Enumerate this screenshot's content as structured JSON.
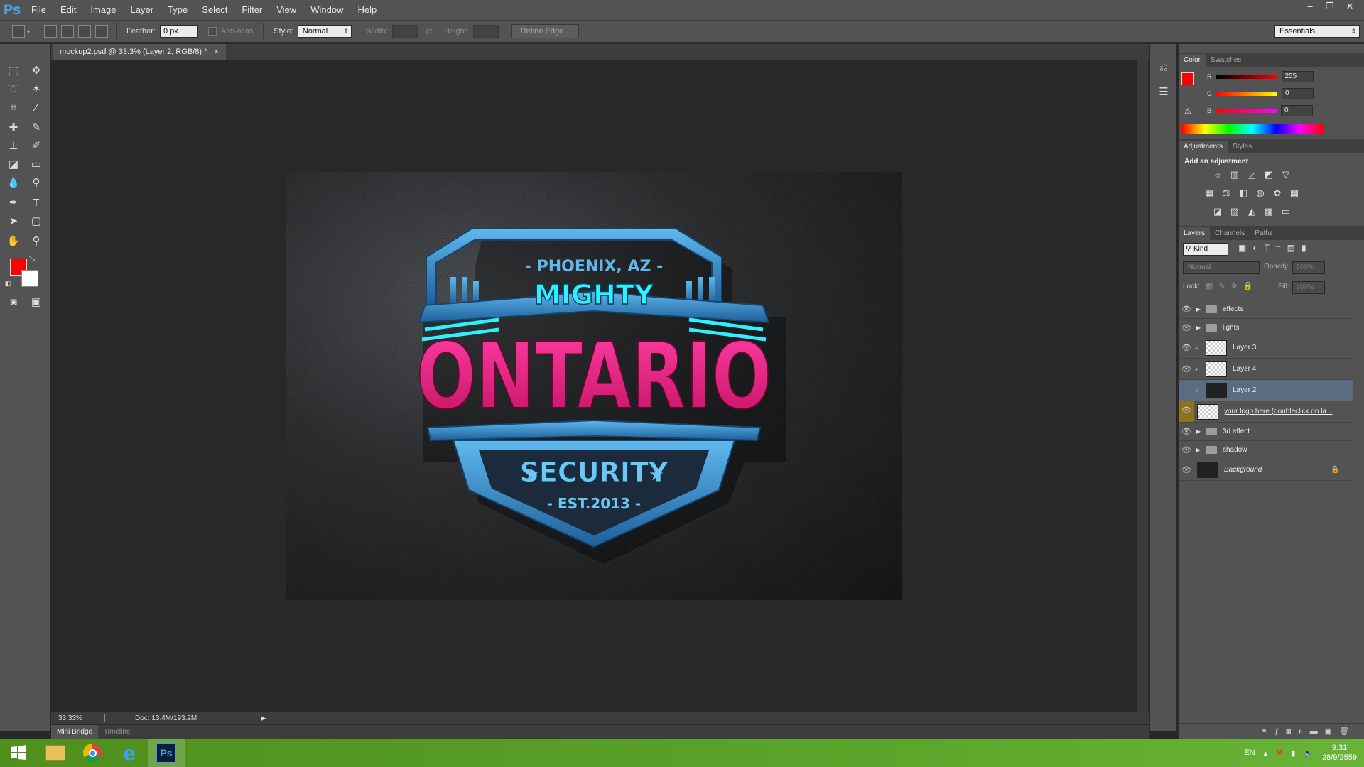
{
  "app": {
    "logo": "Ps"
  },
  "menu": [
    "File",
    "Edit",
    "Image",
    "Layer",
    "Type",
    "Select",
    "Filter",
    "View",
    "Window",
    "Help"
  ],
  "options": {
    "feather_label": "Feather:",
    "feather_value": "0 px",
    "antialias_label": "Anti-alias",
    "style_label": "Style:",
    "style_value": "Normal",
    "width_label": "Width:",
    "height_label": "Height:",
    "refine_label": "Refine Edge...",
    "workspace": "Essentials"
  },
  "document": {
    "tab_title": "mockup2.psd @ 33.3% (Layer 2, RGB/8) *",
    "zoom": "33.33%",
    "doc_size": "Doc: 13.4M/193.2M"
  },
  "logo_art": {
    "location": "- PHOENIX, AZ -",
    "top_word": "MIGHTY",
    "main_word": "ONTARIO",
    "bottom_word": "SECURITY",
    "est": "- EST.2013 -"
  },
  "bottom_tabs": [
    "Mini Bridge",
    "Timeline"
  ],
  "color_panel": {
    "tabs": [
      "Color",
      "Swatches"
    ],
    "r_label": "R",
    "r_value": "255",
    "g_label": "G",
    "g_value": "0",
    "b_label": "B",
    "b_value": "0",
    "fg_color": "#ff0000"
  },
  "adjust_panel": {
    "tabs": [
      "Adjustments",
      "Styles"
    ],
    "heading": "Add an adjustment"
  },
  "layers_panel": {
    "tabs": [
      "Layers",
      "Channels",
      "Paths"
    ],
    "kind_label": "Kind",
    "blend_mode": "Normal",
    "opacity_label": "Opacity:",
    "opacity_value": "100%",
    "lock_label": "Lock:",
    "fill_label": "Fill:",
    "fill_value": "100%",
    "layers": [
      {
        "name": "effects",
        "type": "group"
      },
      {
        "name": "lights",
        "type": "group"
      },
      {
        "name": "Layer 3",
        "type": "layer"
      },
      {
        "name": "Layer 4",
        "type": "layer"
      },
      {
        "name": "Layer 2",
        "type": "layer",
        "selected": true
      },
      {
        "name": "your logo here (doubleclick on la...",
        "type": "smart"
      },
      {
        "name": "3d effect",
        "type": "group"
      },
      {
        "name": "shadow",
        "type": "group"
      },
      {
        "name": "Background",
        "type": "background"
      }
    ]
  },
  "taskbar": {
    "lang": "EN",
    "time": "9:31",
    "date": "28/9/2559"
  }
}
